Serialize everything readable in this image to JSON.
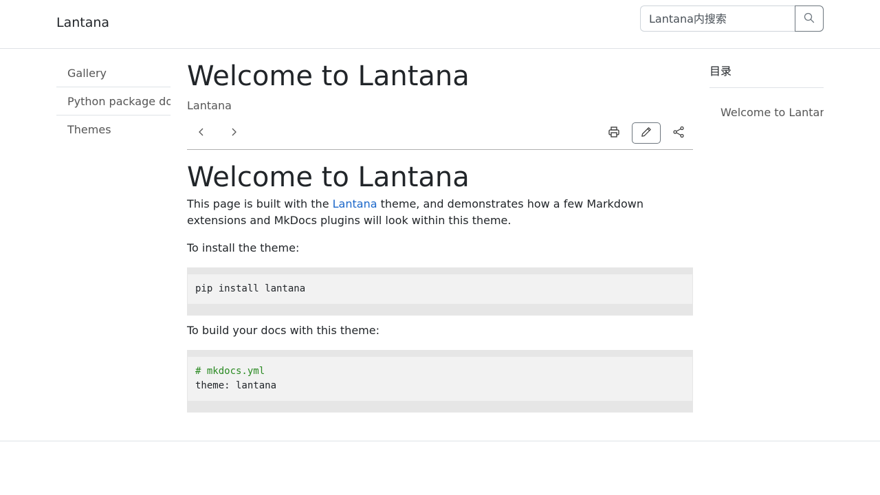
{
  "navbar": {
    "brand": "Lantana",
    "search": {
      "placeholder": "Lantana内搜索"
    }
  },
  "sidebar": {
    "items": [
      {
        "label": "Gallery"
      },
      {
        "label": "Python package docs"
      },
      {
        "label": "Themes"
      }
    ]
  },
  "main": {
    "title": "Welcome to Lantana",
    "subtitle": "Lantana"
  },
  "content": {
    "heading": "Welcome to Lantana",
    "intro_before_link": "This page is built with the ",
    "intro_link": "Lantana",
    "intro_after_link": " theme, and demonstrates how a few Markdown extensions and MkDocs plugins will look within this theme.",
    "install_text": "To install the theme:",
    "install_code": "pip install lantana",
    "build_text": "To build your docs with this theme:",
    "build_code_comment": "# mkdocs.yml",
    "build_code_line": "theme: lantana"
  },
  "toc": {
    "title": "目录",
    "items": [
      {
        "label": "Welcome to Lantana"
      }
    ]
  },
  "icons": {
    "search": "search-icon",
    "prev": "chevron-left-icon",
    "next": "chevron-right-icon",
    "print": "printer-icon",
    "edit": "pencil-icon",
    "share": "share-icon"
  },
  "colors": {
    "link": "#1a66c9",
    "comment": "#2a8a22",
    "code_bg": "#f2f2f2",
    "code_border": "#e6e6e6"
  }
}
